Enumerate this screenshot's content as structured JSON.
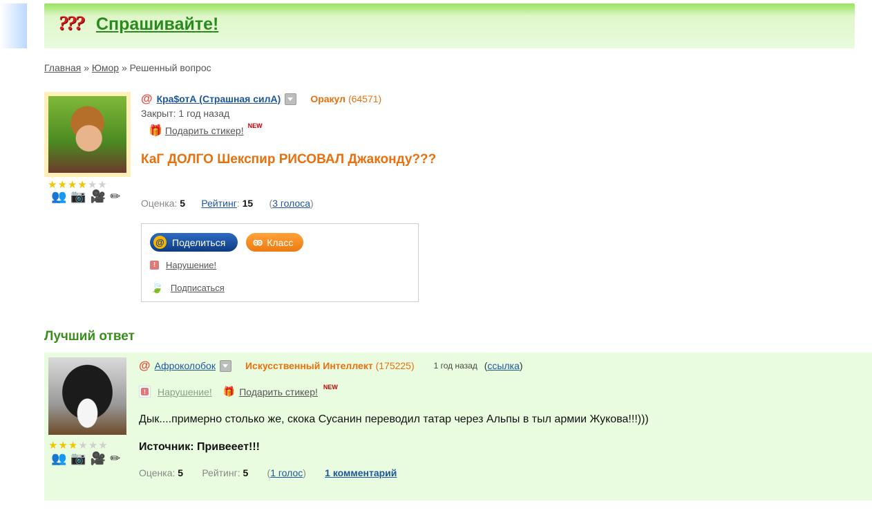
{
  "header": {
    "logo_glyph": "???",
    "title": "Спрашивайте!"
  },
  "breadcrumb": {
    "home": "Главная",
    "sep1": "»",
    "category": "Юмор",
    "sep2": "»",
    "current": "Решенный вопрос"
  },
  "question": {
    "author": "Кра$отА (Страшная силА)",
    "rank": "Оракул",
    "points": "(64571)",
    "closed": "Закрыт: 1 год назад",
    "gift_label": "Подарить стикер!",
    "new_badge": "NEW",
    "title": "КаГ ДОЛГО Шекспир РИСОВАЛ Джаконду???",
    "score_label": "Оценка:",
    "score": "5",
    "rating_label": "Рейтинг",
    "rating": "15",
    "votes": "3 голоса",
    "stars": 4,
    "stars_max": 6
  },
  "share": {
    "share_label": "Поделиться",
    "ok_label": "Класс",
    "report_label": "Нарушение!",
    "subscribe_label": "Подписаться"
  },
  "best_answer": {
    "heading": "Лучший ответ",
    "author": "Афроколобок",
    "rank": "Искусственный Интеллект",
    "points": "(175225)",
    "time": "1 год назад",
    "link_label": "ссылка",
    "report_label": "Нарушение!",
    "gift_label": "Подарить стикер!",
    "new_badge": "NEW",
    "text": "Дык....примерно столько же, скока Сусанин переводил татар через Альпы в тыл армии Жукова!!!)))",
    "source": "Источник: Привееет!!!",
    "score_label": "Оценка:",
    "score": "5",
    "rating_label": "Рейтинг:",
    "rating": "5",
    "votes": "1 голос",
    "comments": "1 комментарий",
    "stars": 3,
    "stars_max": 6
  },
  "colors": {
    "brand_green": "#2a8a1d",
    "rank_orange": "#ea6f0d",
    "link_blue": "#1b56a0",
    "answer_bg": "#eafcdf"
  }
}
